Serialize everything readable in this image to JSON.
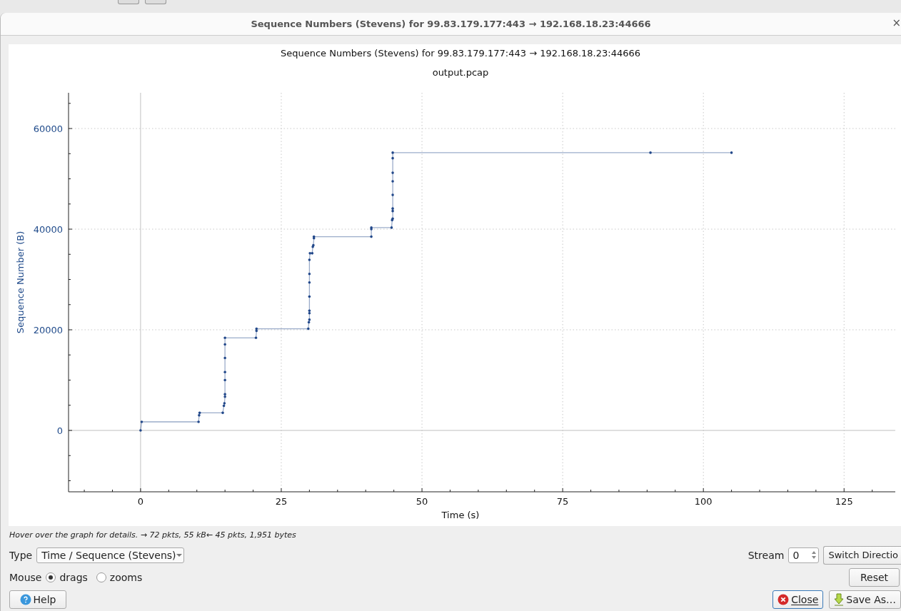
{
  "window": {
    "title": "Sequence Numbers (Stevens) for 99.83.179.177:443 → 192.168.18.23:44666",
    "close_glyph": "×"
  },
  "plot": {
    "file_label": "output.pcap",
    "chart_data": {
      "type": "line",
      "title": "Sequence Numbers (Stevens) for 99.83.179.177:443 → 192.168.18.23:44666",
      "xlabel": "Time (s)",
      "ylabel": "Sequence Number (B)",
      "xlim": [
        -12.8,
        134.1
      ],
      "ylim": [
        -12200,
        67100
      ],
      "xticks": [
        0,
        25,
        50,
        75,
        100,
        125
      ],
      "yticks": [
        0,
        20000,
        40000,
        60000
      ],
      "grid": true,
      "x": [
        0,
        0.2,
        10.3,
        10.4,
        10.5,
        14.6,
        14.8,
        14.9,
        15.0,
        15.0,
        15.0,
        15.0,
        15.0,
        15.0,
        15.0,
        20.5,
        20.6,
        20.6,
        29.8,
        29.9,
        30.0,
        30.0,
        30.0,
        30.0,
        30.0,
        30.0,
        30.0,
        30.1,
        30.5,
        30.6,
        30.7,
        30.8,
        30.8,
        41.0,
        41.0,
        41.0,
        44.6,
        44.7,
        44.8,
        44.8,
        44.8,
        44.8,
        44.8,
        44.8,
        44.8,
        44.8,
        90.6,
        105.0
      ],
      "series": [
        {
          "color": "#22488a",
          "values": [
            0,
            1700,
            1700,
            3000,
            3500,
            3500,
            4900,
            5400,
            6700,
            7200,
            10000,
            11600,
            14400,
            17100,
            18400,
            18400,
            19800,
            20200,
            20200,
            21500,
            22000,
            23300,
            23800,
            26600,
            29400,
            31100,
            33900,
            35200,
            35200,
            36500,
            36800,
            38200,
            38500,
            38500,
            40000,
            40300,
            40300,
            41800,
            42100,
            43600,
            44100,
            46800,
            49500,
            51200,
            54100,
            55200,
            55200,
            55200
          ]
        }
      ]
    }
  },
  "hint": "Hover over the graph for details. → 72 pkts, 55 kB← 45 pkts, 1,951 bytes",
  "type_label": "Type",
  "type_value": "Time / Sequence (Stevens)",
  "stream_label": "Stream",
  "stream_value": "0",
  "switch_button": "Switch Directio",
  "mouse_label": "Mouse",
  "mouse_options": [
    {
      "label": "drags",
      "selected": true
    },
    {
      "label": "zooms",
      "selected": false
    }
  ],
  "reset_button": "Reset",
  "help_button": "Help",
  "close_button": "Close",
  "save_button": "Save As…"
}
